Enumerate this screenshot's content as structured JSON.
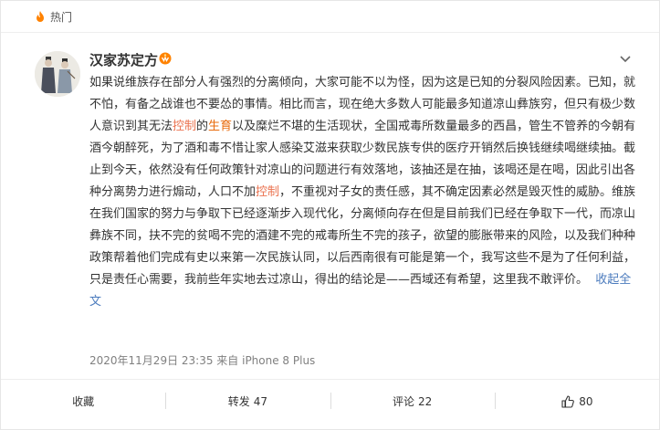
{
  "hot": {
    "label": "热门"
  },
  "post": {
    "username": "汉家苏定方",
    "content": {
      "p1": "如果说维族存在部分人有强烈的分离倾向，大家可能不以为怪，因为这是已知的分裂风险因素。已知，就不怕，有备之战谁也不要怂的事情。相比而言，现在绝大多数人可能最多知道凉山彝族穷，但只有极少数人意识到其无法",
      "hl1": "控制",
      "p2": "的",
      "hl2": "生育",
      "p3": "以及糜烂不堪的生活现状，全国戒毒所数量最多的西昌，管生不管养的今朝有酒今朝醉死，为了酒和毒不惜让家人感染艾滋来获取少数民族专供的医疗开销然后换钱继续喝继续抽。截止到今天，依然没有任何政策针对凉山的问题进行有效落地，该抽还是在抽，该喝还是在喝，因此引出各种分离势力进行煽动，人口不加",
      "hl3": "控制",
      "p4": "，不重视对子女的责任感，其不确定因素必然是毁灭性的威胁。维族在我们国家的努力与争取下已经逐渐步入现代化，分离倾向存在但是目前我们已经在争取下一代，而凉山彝族不同，扶不完的贫喝不完的酒建不完的戒毒所生不完的孩子，欲望的膨胀带来的风险，以及我们种种政策帮着他们完成有史以来第一次民族认同，以后西南很有可能是第一个，我写这些不是为了任何利益，只是责任心需要，我前些年实地去过凉山，得出的结论是——西域还有希望，这里我不敢评价。",
      "collapse": "收起全文"
    },
    "meta": "2020年11月29日 23:35  来自 iPhone 8 Plus"
  },
  "actions": {
    "favorite": "收藏",
    "repost_label": "转发",
    "repost_count": "47",
    "comment_label": "评论",
    "comment_count": "22",
    "like_count": "80"
  },
  "colors": {
    "highlight": "#e86b0c",
    "link": "#4b7bbd",
    "badge": "#ff8200"
  },
  "icons": {
    "hot": "fire-icon",
    "badge": "vip-badge-icon",
    "chevron": "chevron-down-icon",
    "like": "thumbs-up-icon"
  }
}
